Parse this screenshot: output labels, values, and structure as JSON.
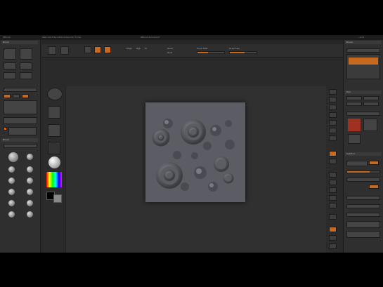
{
  "titlebar": {
    "app": "ZBrush",
    "info": "Mem 0/0 Free 2016 Active Info Timer",
    "doc": "ZBrush Document"
  },
  "left_panel": {
    "title": "Brush",
    "lightbox_label": "Lightbox",
    "subtool_label": "Brush"
  },
  "right_panel": {
    "title": "Brush",
    "tool_label": "Tool",
    "subtool_label": "SubTool"
  },
  "top_shelf": {
    "mrgb": "Mrgb",
    "rgb": "Rgb",
    "m": "M",
    "zadd": "Zadd",
    "zsub": "Zsub",
    "focal": "Focal Shift",
    "draw": "Draw Size"
  },
  "colors": {
    "accent": "#c56a20",
    "background": "#2a2a2a",
    "panel": "#2f2f2f"
  },
  "icons": [
    "brush-icon",
    "stroke-icon",
    "alpha-icon",
    "texture-icon",
    "material-icon",
    "color-picker-icon",
    "scroll-icon",
    "zoom-icon",
    "move-icon",
    "rotate-icon"
  ]
}
